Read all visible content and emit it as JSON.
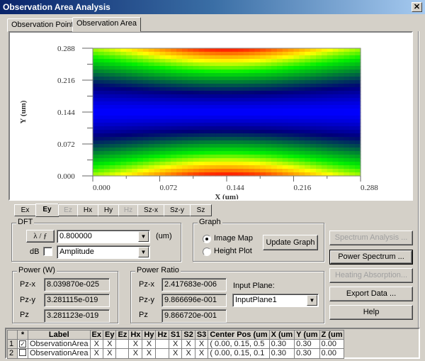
{
  "window": {
    "title": "Observation Area Analysis",
    "close_label": "✕"
  },
  "tabs": [
    {
      "label": "Observation Point",
      "active": false
    },
    {
      "label": "Observation Area",
      "active": true
    }
  ],
  "chart_data": {
    "type": "heatmap",
    "title": "",
    "xlabel": "X (um)",
    "ylabel": "Y (um)",
    "xlim": [
      0.0,
      0.288
    ],
    "ylim": [
      0.0,
      0.288
    ],
    "x_ticks": [
      "0.000",
      "0.072",
      "0.144",
      "0.216",
      "0.288"
    ],
    "y_ticks": [
      "0.000",
      "0.072",
      "0.144",
      "0.216",
      "0.288"
    ],
    "colormap": [
      "#0000ff",
      "#00007f",
      "#00ff00",
      "#ffff00",
      "#ff0000"
    ],
    "description": "Field intensity map: minimum (blue) band centered at y=0.144, maxima (red) at y=0 and y=0.288 near x=0.144",
    "field_peaks": [
      {
        "x": 0.144,
        "y": 0.288,
        "level": "max"
      },
      {
        "x": 0.144,
        "y": 0.0,
        "level": "max"
      },
      {
        "x": 0.144,
        "y": 0.144,
        "level": "min"
      }
    ]
  },
  "field_tabs": [
    {
      "label": "Ex",
      "state": "normal"
    },
    {
      "label": "Ey",
      "state": "active"
    },
    {
      "label": "Ez",
      "state": "disabled"
    },
    {
      "label": "Hx",
      "state": "normal"
    },
    {
      "label": "Hy",
      "state": "normal"
    },
    {
      "label": "Hz",
      "state": "disabled"
    },
    {
      "label": "Sz-x",
      "state": "normal"
    },
    {
      "label": "Sz-y",
      "state": "normal"
    },
    {
      "label": "Sz",
      "state": "normal"
    }
  ],
  "dft": {
    "group_label": "DFT",
    "lambda_button": "λ / ƒ",
    "wavelength_value": "0.800000",
    "unit": "(um)",
    "db_label": "dB",
    "db_checked": false,
    "mode_value": "Amplitude"
  },
  "graph": {
    "group_label": "Graph",
    "options": [
      {
        "label": "Image Map",
        "selected": true
      },
      {
        "label": "Height Plot",
        "selected": false
      }
    ],
    "update_button": "Update Graph"
  },
  "side_buttons": [
    {
      "label": "Spectrum Analysis ...",
      "enabled": false
    },
    {
      "label": "Power Spectrum ...",
      "enabled": true
    },
    {
      "label": "Heating Absorption...",
      "enabled": false
    },
    {
      "label": "Export Data ...",
      "enabled": true
    },
    {
      "label": "Help",
      "enabled": true
    }
  ],
  "power": {
    "group_label": "Power (W)",
    "rows": [
      {
        "label": "Pz-x",
        "value": "8.039870e-025"
      },
      {
        "label": "Pz-y",
        "value": "3.281115e-019"
      },
      {
        "label": "Pz",
        "value": "3.281123e-019"
      }
    ]
  },
  "power_ratio": {
    "group_label": "Power Ratio",
    "rows": [
      {
        "label": "Pz-x",
        "value": "2.417683e-006"
      },
      {
        "label": "Pz-y",
        "value": "9.866696e-001"
      },
      {
        "label": "Pz",
        "value": "9.866720e-001"
      }
    ],
    "input_plane_label": "Input Plane:",
    "input_plane_value": "InputPlane1"
  },
  "grid": {
    "columns": [
      "",
      "*",
      "Label",
      "Ex",
      "Ey",
      "Ez",
      "Hx",
      "Hy",
      "Hz",
      "S1",
      "S2",
      "S3",
      "Center Pos (um",
      "X (um",
      "Y (um",
      "Z (um"
    ],
    "rows": [
      {
        "num": "1",
        "checked": true,
        "cells": [
          "ObservationArea",
          "X",
          "X",
          "",
          "X",
          "X",
          "",
          "X",
          "X",
          "X",
          "( 0.00, 0.15, 0.5",
          "0.30",
          "0.30",
          "0.00"
        ]
      },
      {
        "num": "2",
        "checked": false,
        "cells": [
          "ObservationArea",
          "X",
          "X",
          "",
          "X",
          "X",
          "",
          "X",
          "X",
          "X",
          "( 0.00, 0.15, 0.1",
          "0.30",
          "0.30",
          "0.00"
        ]
      }
    ]
  }
}
